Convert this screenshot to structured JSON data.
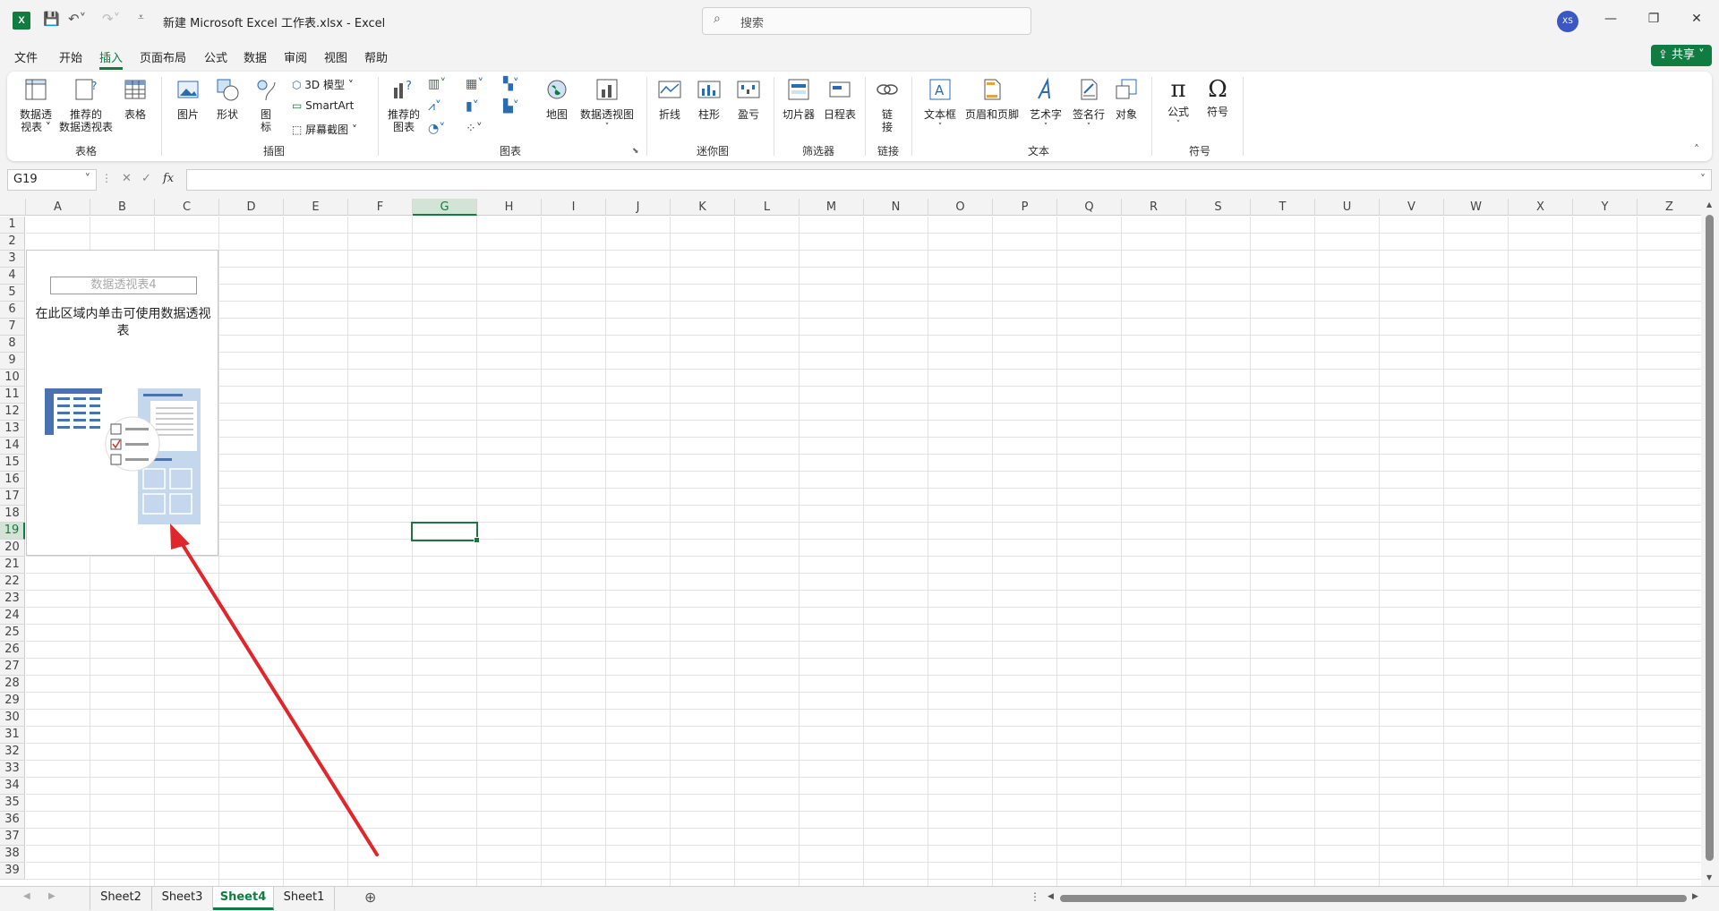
{
  "titlebar": {
    "app_icon": "X",
    "title": "新建 Microsoft Excel 工作表.xlsx  -  Excel",
    "search_placeholder": "搜索",
    "avatar": "XS"
  },
  "menu": {
    "items": [
      "文件",
      "开始",
      "插入",
      "页面布局",
      "公式",
      "数据",
      "审阅",
      "视图",
      "帮助"
    ],
    "active": "插入",
    "share_label": "共享"
  },
  "ribbon": {
    "groups": [
      {
        "label": "表格",
        "buttons": [
          "数据透\n视表 ˅",
          "推荐的\n数据透视表",
          "表格"
        ]
      },
      {
        "label": "插图",
        "buttons": [
          "图片",
          "形状",
          "图\n标"
        ],
        "small": [
          "3D 模型",
          "SmartArt",
          "屏幕截图"
        ]
      },
      {
        "label": "图表",
        "buttons": [
          "推荐的\n图表",
          "地图",
          "数据透视图"
        ]
      },
      {
        "label": "迷你图",
        "buttons": [
          "折线",
          "柱形",
          "盈亏"
        ]
      },
      {
        "label": "筛选器",
        "buttons": [
          "切片器",
          "日程表"
        ]
      },
      {
        "label": "链接",
        "buttons": [
          "链\n接"
        ]
      },
      {
        "label": "文本",
        "buttons": [
          "文本框",
          "页眉和页脚",
          "艺术字",
          "签名行",
          "对象"
        ]
      },
      {
        "label": "符号",
        "buttons": [
          "公式",
          "符号"
        ]
      }
    ]
  },
  "formula_bar": {
    "name_box": "G19",
    "fx": "fx",
    "value": ""
  },
  "grid": {
    "columns": [
      "A",
      "B",
      "C",
      "D",
      "E",
      "F",
      "G",
      "H",
      "I",
      "J",
      "K",
      "L",
      "M",
      "N",
      "O",
      "P",
      "Q",
      "R",
      "S",
      "T",
      "U",
      "V",
      "W",
      "X",
      "Y",
      "Z"
    ],
    "rows": [
      "1",
      "2",
      "3",
      "4",
      "5",
      "6",
      "7",
      "8",
      "9",
      "10",
      "11",
      "12",
      "13",
      "14",
      "15",
      "16",
      "17",
      "18",
      "19",
      "20",
      "21",
      "22",
      "23",
      "24",
      "25",
      "26",
      "27",
      "28",
      "29",
      "30",
      "31",
      "32",
      "33",
      "34",
      "35",
      "36",
      "37",
      "38",
      "39"
    ],
    "selected_cell": "G19"
  },
  "pivot": {
    "name": "数据透视表4",
    "hint": "在此区域内单击可使用数据透视表"
  },
  "sheets": {
    "tabs": [
      "Sheet2",
      "Sheet3",
      "Sheet4",
      "Sheet1"
    ],
    "active": "Sheet4"
  },
  "colors": {
    "accent": "#107c41",
    "arrow": "#e0262b"
  }
}
